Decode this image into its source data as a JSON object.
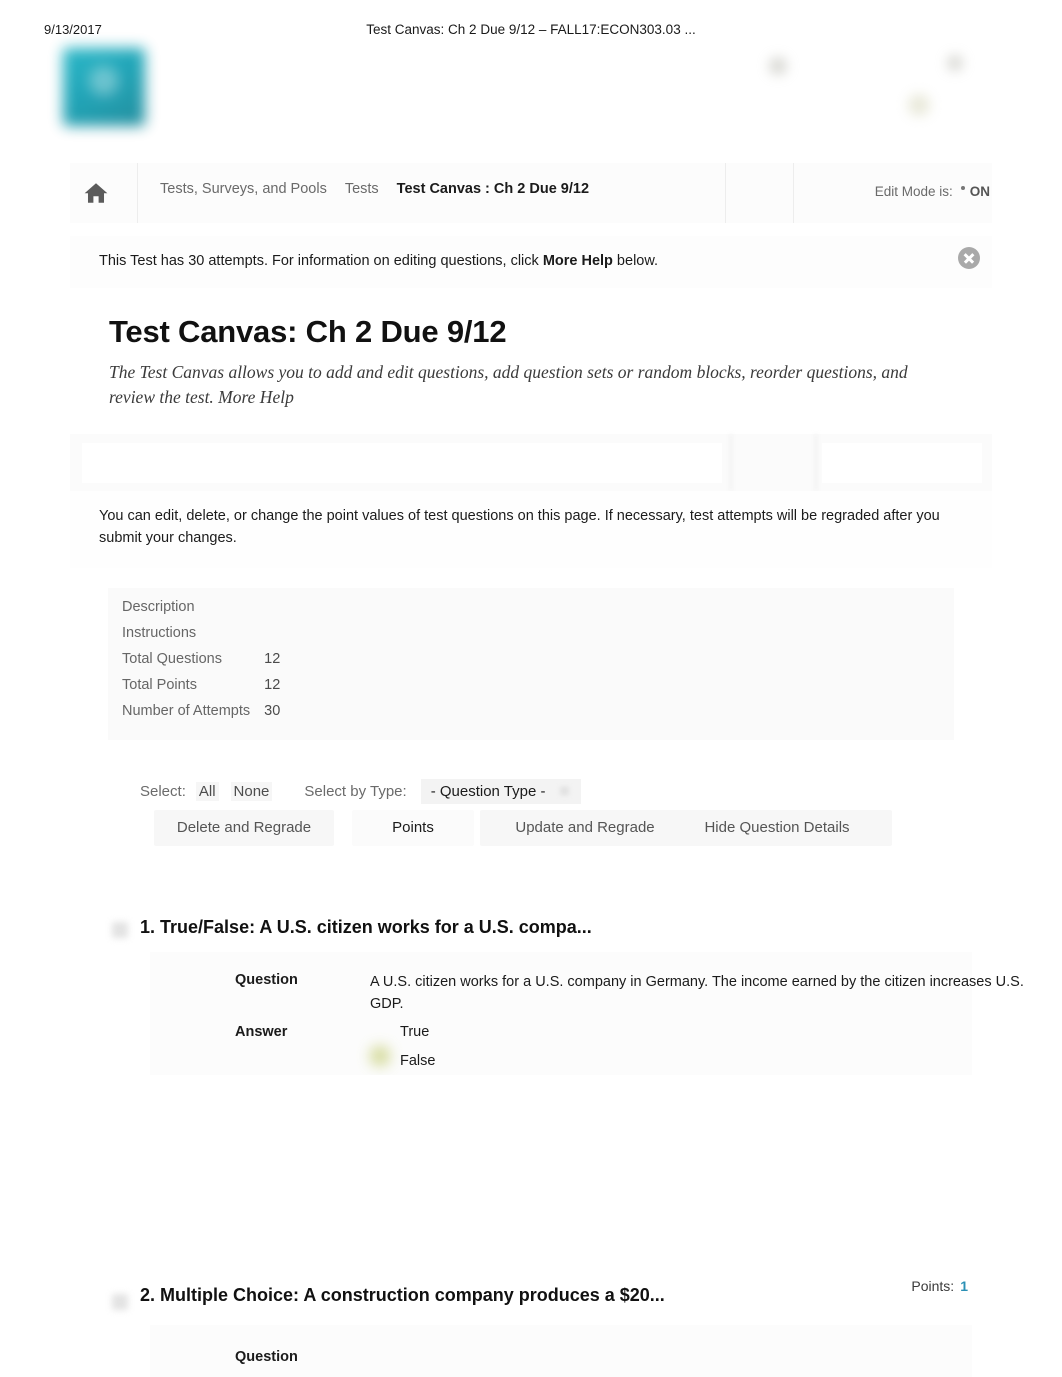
{
  "print": {
    "date": "9/13/2017",
    "title": "Test Canvas: Ch 2 Due 9/12 – FALL17:ECON303.03 ..."
  },
  "brand": {
    "logo_name": "blackboard-logo",
    "accent_color": "#1aa3b6"
  },
  "breadcrumb": {
    "home_icon": "home-icon",
    "items": [
      {
        "label": "Tests, Surveys, and Pools",
        "current": false
      },
      {
        "label": "Tests",
        "current": false
      },
      {
        "label": "Test Canvas : Ch 2 Due 9/12",
        "current": true
      }
    ]
  },
  "edit_mode": {
    "label": "Edit Mode is:",
    "state": "ON"
  },
  "notice": {
    "text_before": "This Test has 30 attempts. For information on editing questions, click ",
    "bold": "More Help",
    "text_after": " below.",
    "close_icon": "close-icon"
  },
  "page": {
    "title": "Test Canvas: Ch 2 Due 9/12",
    "description": "The Test Canvas allows you to add and edit questions, add question sets or random blocks, reorder questions, and review the test. More Help"
  },
  "instruction": {
    "text": "You can edit, delete, or change the point values of test questions on this page. If necessary, test attempts will be regraded after you submit your changes."
  },
  "test_info": {
    "rows": [
      {
        "label": "Description",
        "value": ""
      },
      {
        "label": "Instructions",
        "value": ""
      },
      {
        "label": "Total Questions",
        "value": "12"
      },
      {
        "label": "Total Points",
        "value": "12"
      },
      {
        "label": "Number of Attempts",
        "value": "30"
      }
    ]
  },
  "select_bar": {
    "select_label": "Select:",
    "all_label": "All",
    "none_label": "None",
    "by_type_label": "Select by Type:",
    "type_selected": "- Question Type -"
  },
  "buttons": {
    "delete_and_regrade": "Delete and Regrade",
    "points": "Points",
    "update_and_regrade": "Update and Regrade",
    "hide_question_details": "Hide Question Details"
  },
  "questions": [
    {
      "number": "1.",
      "heading": "True/False: A U.S. citizen works for a U.S. compa...",
      "points_label": "",
      "points_value": "",
      "question_label": "Question",
      "question_text": "A U.S. citizen works for a U.S. company in Germany. The income earned by the citizen increases U.S. GDP.",
      "answer_label": "Answer",
      "answers": [
        {
          "text": "True",
          "correct": false
        },
        {
          "text": "False",
          "correct": true
        }
      ]
    },
    {
      "number": "2.",
      "heading": "Multiple Choice: A construction company produces a $20...",
      "points_label": "Points:",
      "points_value": "1",
      "question_label": "Question",
      "question_text": "",
      "answer_label": "",
      "answers": []
    }
  ]
}
